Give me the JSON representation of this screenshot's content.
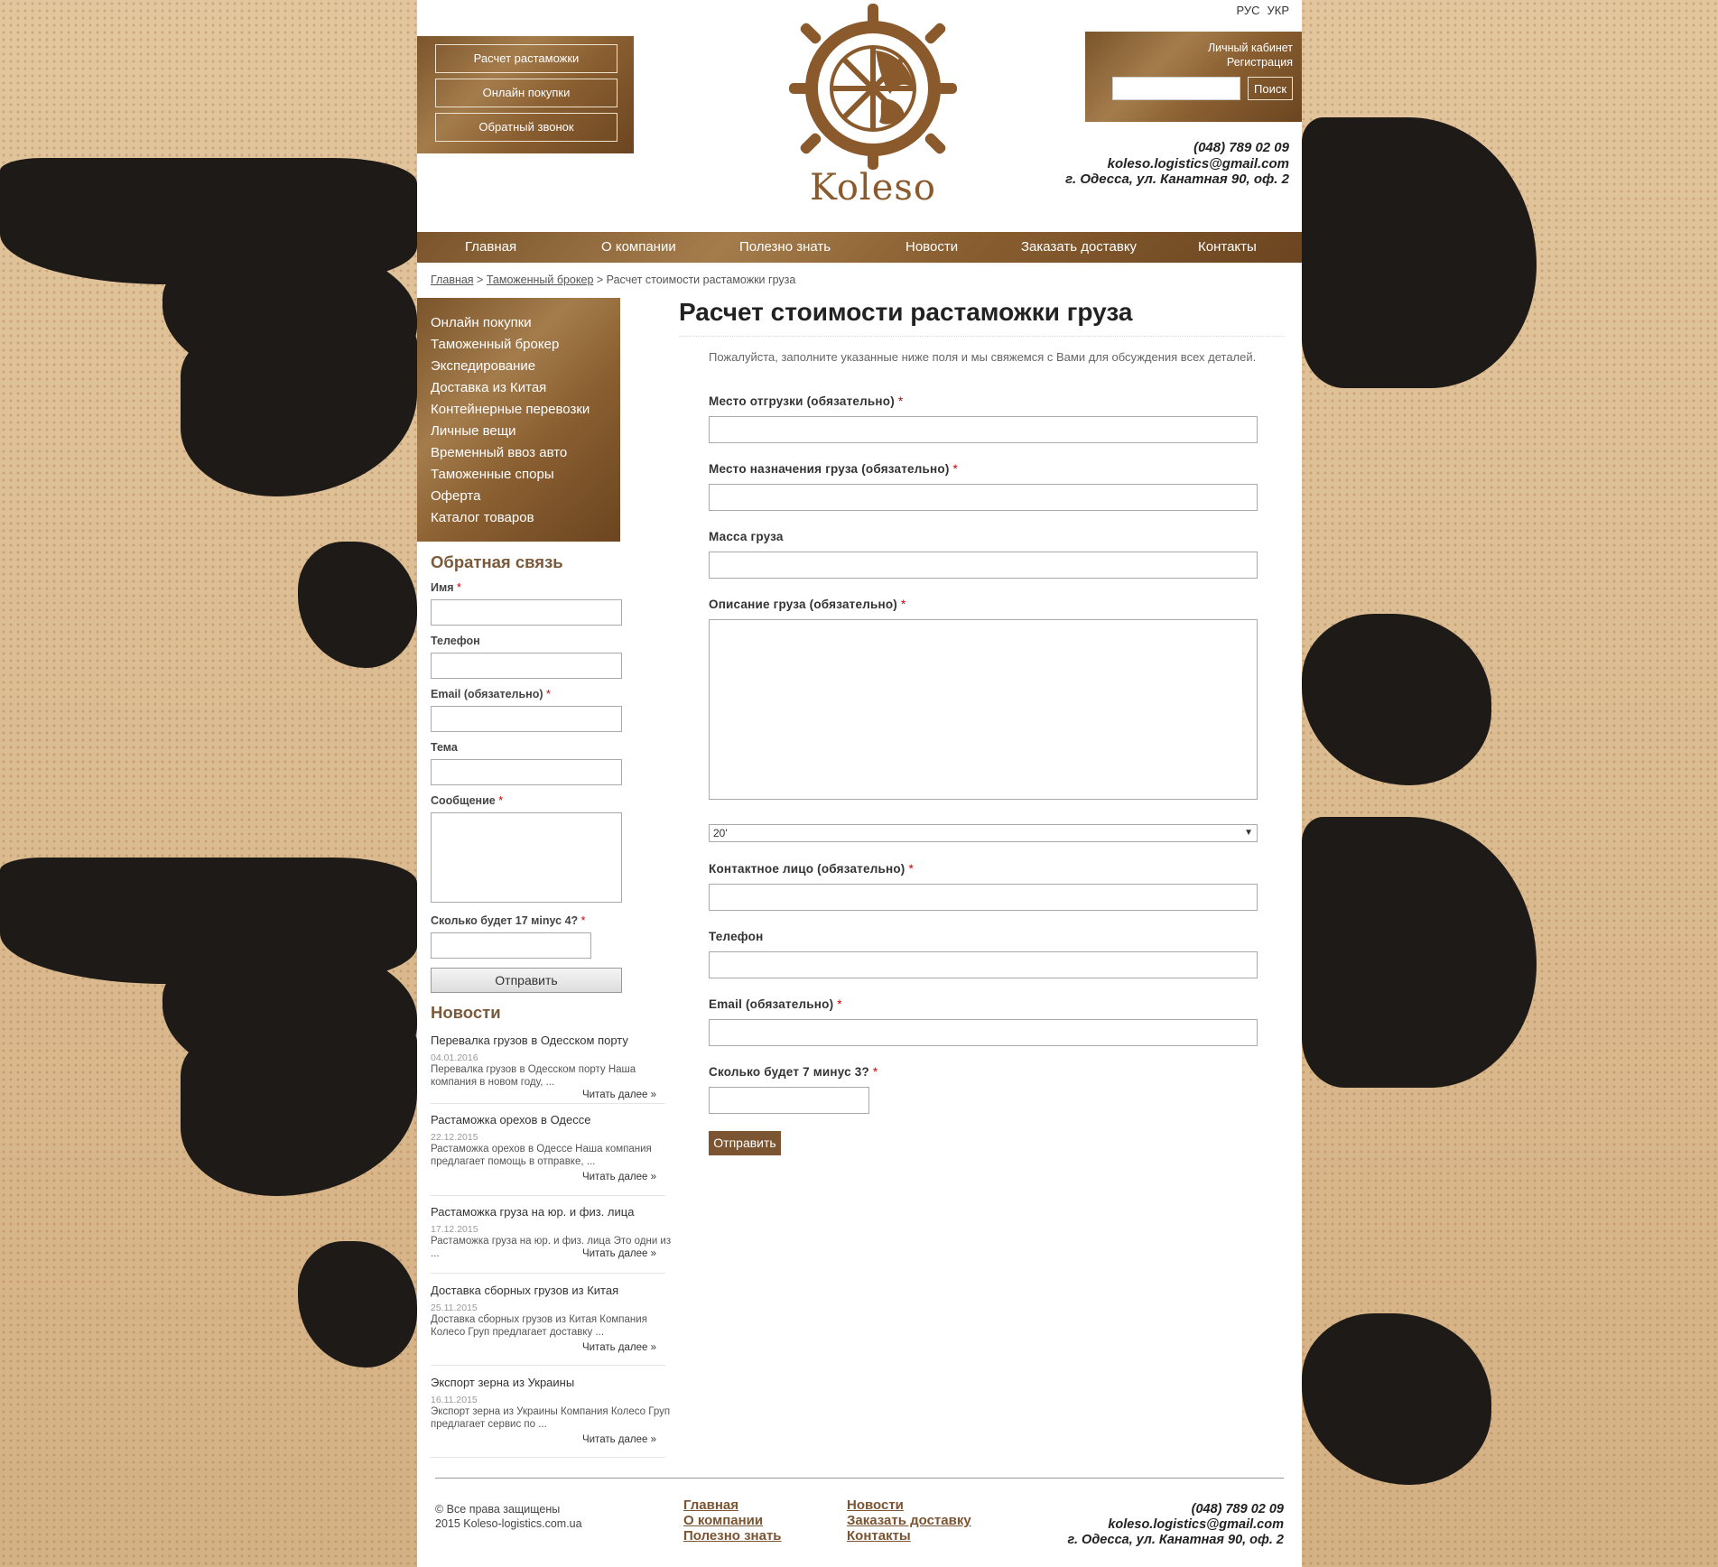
{
  "header": {
    "left_buttons": [
      "Расчет растаможки",
      "Онлайн покупки",
      "Обратный звонок"
    ],
    "logo_text": "Koleso",
    "lang": [
      "РУС",
      "УКР"
    ],
    "account_link": "Личный кабинет",
    "register_link": "Регистрация",
    "search_button": "Поиск",
    "phone": "(048) 789 02 09",
    "email": "koleso.logistics@gmail.com",
    "address": "г. Одесса, ул. Канатная 90, оф. 2"
  },
  "nav": [
    "Главная",
    "О компании",
    "Полезно знать",
    "Новости",
    "Заказать доставку",
    "Контакты"
  ],
  "breadcrumb": {
    "home": "Главная",
    "sep1": " > ",
    "section": "Таможенный брокер",
    "sep2": " > ",
    "current": "Расчет стоимости растаможки груза"
  },
  "sidebar": {
    "menu": [
      "Онлайн покупки",
      "Таможенный брокер",
      "Экспедирование",
      "Доставка из Китая",
      "Контейнерные перевозки",
      "Личные вещи",
      "Временный ввоз авто",
      "Таможенные споры",
      "Оферта",
      "Каталог товаров"
    ],
    "feedback": {
      "title": "Обратная связь",
      "name_label": "Имя",
      "phone_label": "Телефон",
      "email_label": "Email (обязательно)",
      "subject_label": "Тема",
      "message_label": "Сообщение",
      "captcha_label": "Сколько будет 17 мinус 4?",
      "submit": "Отправить"
    },
    "news_title": "Новости",
    "news": [
      {
        "title": "Перевалка грузов в Одесском порту",
        "date": "04.01.2016",
        "text": "Перевалка грузов в Одесском порту Наша компания в новом году, ...",
        "more": "Читать далее »"
      },
      {
        "title": "Растаможка орехов в Одессе",
        "date": "22.12.2015",
        "text": "Растаможка орехов в Одессе Наша компания предлагает помощь в отправке, ...",
        "more": "Читать далее »"
      },
      {
        "title": "Растаможка груза на юр. и физ. лица",
        "date": "17.12.2015",
        "text": "Растаможка груза на юр. и физ. лица Это одни из ...",
        "more": "Читать далее »"
      },
      {
        "title": "Доставка сборных грузов из Китая",
        "date": "25.11.2015",
        "text": "Доставка сборных грузов из Китая Компания Колесо Груп предлагает доставку ...",
        "more": "Читать далее »"
      },
      {
        "title": "Экспорт зерна из Украины",
        "date": "16.11.2015",
        "text": "Экспорт зерна из Украины Компания Колесо Груп предлагает сервис по ...",
        "more": "Читать далее »"
      }
    ]
  },
  "main": {
    "title": "Расчет стоимости растаможки груза",
    "intro": "Пожалуйста, заполните указанные ниже поля и мы свяжемся с Вами для обсуждения всех деталей.",
    "fields": {
      "shipment_place": "Место отгрузки (обязательно)",
      "destination": "Место назначения груза (обязательно)",
      "weight": "Масса груза",
      "description": "Описание груза (обязательно)",
      "container_selected": "20'",
      "contact_person": "Контактное лицо (обязательно)",
      "phone": "Телефон",
      "email": "Email (обязательно)",
      "captcha": "Сколько будет 7 минус 3?"
    },
    "required_mark": "*",
    "submit": "Отправить"
  },
  "footer": {
    "copyright": "© Все права защищены",
    "copyright2": "2015 Koleso-logistics.com.ua",
    "links_col1": [
      "Главная",
      "О компании",
      "Полезно знать"
    ],
    "links_col2": [
      "Новости",
      "Заказать доставку",
      "Контакты"
    ],
    "phone": "(048) 789 02 09",
    "email": "koleso.logistics@gmail.com",
    "address": "г. Одесса, ул. Канатная 90, оф. 2"
  },
  "colors": {
    "brand_brown": "#7b5431",
    "background_tan": "#d9b98d",
    "map_dark": "#1e1a17"
  }
}
